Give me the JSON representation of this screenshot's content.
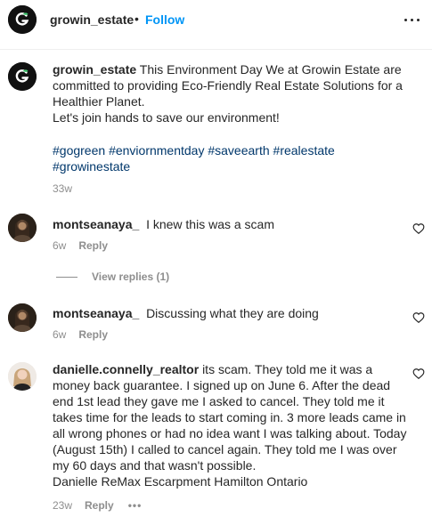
{
  "header": {
    "username": "growin_estate",
    "separator": "•",
    "follow_label": "Follow"
  },
  "caption": {
    "username": "growin_estate",
    "text": "This Environment Day We at Growin Estate are committed to providing Eco-Friendly Real Estate Solutions for a Healthier Planet.",
    "text2": "Let's join hands to save our environment!",
    "hashtags": [
      "#gogreen",
      "#enviornmentday",
      "#saveearth",
      "#realestate",
      "#growinestate"
    ],
    "time": "33w"
  },
  "comments": [
    {
      "username": "montseanaya_",
      "text": "I knew this was a scam",
      "time": "6w",
      "reply_label": "Reply",
      "view_replies": "View replies (1)"
    },
    {
      "username": "montseanaya_",
      "text": "Discussing what they are doing",
      "time": "6w",
      "reply_label": "Reply"
    },
    {
      "username": "danielle.connelly_realtor",
      "text": "its scam. They told me it was a money back guarantee. I signed up on June 6. After the dead end 1st lead they gave me I asked to cancel. They told me it takes time for the leads to start coming in. 3 more leads came in all wrong phones or had no idea want I was talking about. Today (August 15th) I called to cancel again. They told me I was over my 60 days and that wasn't possible.",
      "signature": "Danielle ReMax Escarpment Hamilton Ontario",
      "time": "23w",
      "reply_label": "Reply",
      "more": "•••"
    }
  ],
  "colors": {
    "accent": "#0095f6",
    "hashtag": "#00376b",
    "muted": "#8e8e8e",
    "text": "#262626"
  },
  "icons": [
    "more-options-icon",
    "heart-icon",
    "growin-logo"
  ]
}
